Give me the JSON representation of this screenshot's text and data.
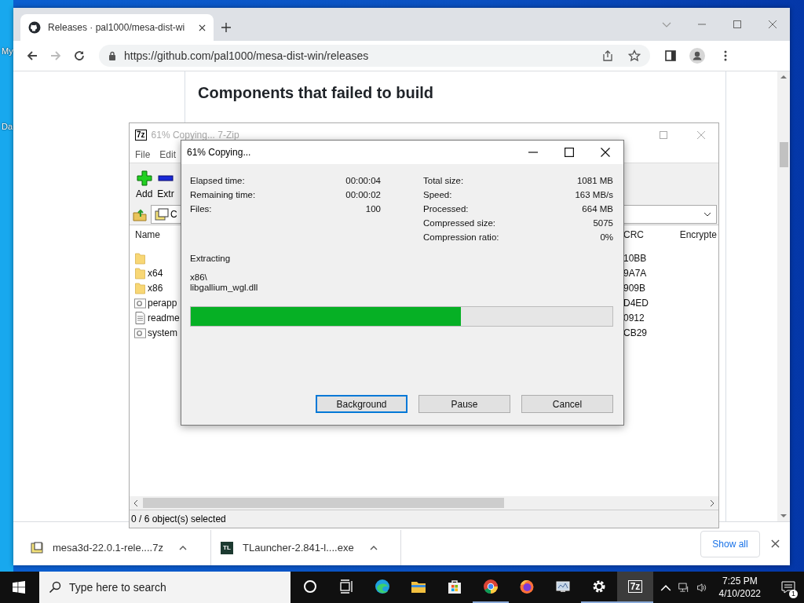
{
  "desktop": {
    "icons": [
      {
        "label": "My"
      },
      {
        "label": "Da"
      }
    ]
  },
  "browser": {
    "tabs": [
      {
        "title": "Releases · pal1000/mesa-dist-wi",
        "selected": true
      }
    ],
    "nav": [
      {
        "kind": "back",
        "disabled": false
      },
      {
        "kind": "forward",
        "disabled": true
      },
      {
        "kind": "reload",
        "disabled": false
      }
    ],
    "url": "https://github.com/pal1000/mesa-dist-win/releases",
    "page": {
      "heading": "Components that failed to build"
    },
    "downloads": {
      "items": [
        {
          "name": "mesa3d-22.0.1-rele....7z",
          "kind": "archive"
        },
        {
          "name": "TLauncher-2.841-l....exe",
          "kind": "launcher",
          "icon_text": "TL"
        }
      ],
      "show_all": "Show all"
    }
  },
  "sevenzip": {
    "logo": "7z",
    "title": "61% Copying... 7-Zip",
    "active": false,
    "menu": [
      "File",
      "Edit"
    ],
    "toolbar": [
      {
        "label": "Add",
        "kind": "add"
      },
      {
        "label": "Extr",
        "kind": "extract"
      }
    ],
    "path": "C",
    "columns": [
      "Name",
      "CRC",
      "Encrypte"
    ],
    "rows": [
      {
        "kind": "folder",
        "crc": "10BB"
      },
      {
        "kind": "folder",
        "name": "x64",
        "crc": "9A7A"
      },
      {
        "kind": "folder",
        "name": "x86",
        "crc": "909B"
      },
      {
        "kind": "settings",
        "name": "perapp",
        "crc": "D4ED"
      },
      {
        "kind": "text",
        "name": "readme",
        "crc": "0912"
      },
      {
        "kind": "settings",
        "name": "system",
        "crc": "CB29"
      }
    ],
    "status": "0 / 6 object(s) selected"
  },
  "dialog": {
    "title": "61% Copying...",
    "active": true,
    "left_stats": [
      {
        "label": "Elapsed time:",
        "value": "00:00:04"
      },
      {
        "label": "Remaining time:",
        "value": "00:00:02"
      },
      {
        "label": "Files:",
        "value": "100"
      }
    ],
    "right_stats": [
      {
        "label": "Total size:",
        "value": "1081 MB"
      },
      {
        "label": "Speed:",
        "value": "163 MB/s"
      },
      {
        "label": "Processed:",
        "value": "664 MB"
      },
      {
        "label": "Compressed size:",
        "value": "5075"
      },
      {
        "label": "Compression ratio:",
        "value": "0%"
      }
    ],
    "action": "Extracting",
    "path_lines": [
      "x86\\",
      "libgallium_wgl.dll"
    ],
    "progress": {
      "level": 0.64
    },
    "buttons": [
      {
        "label": "Background",
        "focused": true
      },
      {
        "label": "Pause",
        "focused": false
      },
      {
        "label": "Cancel",
        "focused": false
      }
    ]
  },
  "taskbar": {
    "search_placeholder": "Type here to search",
    "apps": [
      {
        "kind": "cortana",
        "running": false,
        "active": false
      },
      {
        "kind": "taskview",
        "running": false,
        "active": false
      },
      {
        "kind": "edge",
        "running": false,
        "active": false
      },
      {
        "kind": "explorer",
        "running": false,
        "active": false
      },
      {
        "kind": "store",
        "running": false,
        "active": false
      },
      {
        "kind": "chrome",
        "running": true,
        "active": false
      },
      {
        "kind": "firefox",
        "running": false,
        "active": false
      },
      {
        "kind": "monitor",
        "running": false,
        "active": false
      },
      {
        "kind": "settings",
        "running": true,
        "active": false
      },
      {
        "kind": "sevenzip",
        "running": true,
        "active": true,
        "logo": "7z"
      }
    ],
    "time": "7:25 PM",
    "date": "4/10/2022",
    "notifications": "1"
  }
}
